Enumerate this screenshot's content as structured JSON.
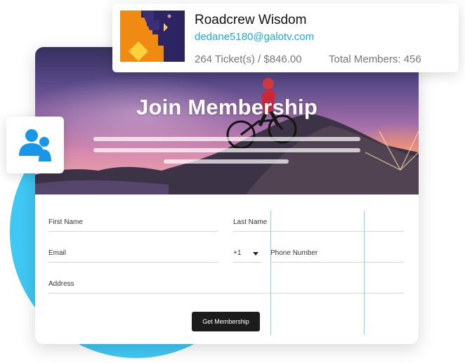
{
  "hero": {
    "title": "Join Membership"
  },
  "form": {
    "first_name_label": "First Name",
    "last_name_label": "Last Name",
    "email_label": "Email",
    "country_code": "+1",
    "phone_label": "Phone Number",
    "address_label": "Address",
    "submit_label": "Get Membership"
  },
  "profile": {
    "name": "Roadcrew Wisdom",
    "email": "dedane5180@galotv.com",
    "tickets_summary": "264 Ticket(s) / $846.00",
    "members_summary": "Total Members: 456"
  },
  "colors": {
    "accent": "#3fc8f4",
    "email_link": "#1aa9e0",
    "button_bg": "#1c1c1c",
    "users_icon": "#1a96e8"
  },
  "icons": {
    "members_badge": "users-icon",
    "phone_country": "chevron-down-icon"
  }
}
